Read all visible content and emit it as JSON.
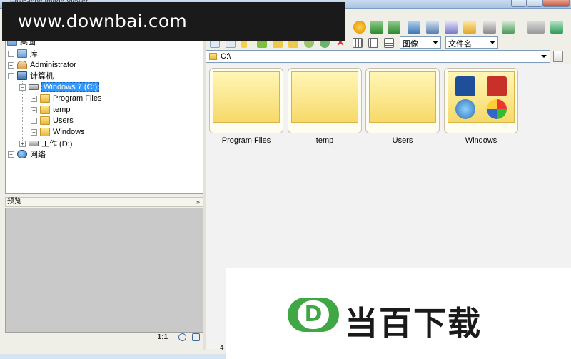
{
  "window": {
    "title": "FastStone Image Viewer"
  },
  "watermark_top": "www.downbai.com",
  "watermark_bottom": "当百下载",
  "toolbar": {
    "view_combo": "图像",
    "sort_combo": "文件名"
  },
  "path": "C:\\",
  "tree": {
    "desktop": "桌面",
    "items": [
      {
        "label": "库",
        "icon": "library-icon"
      },
      {
        "label": "Administrator",
        "icon": "user-folder-icon"
      },
      {
        "label": "计算机",
        "icon": "computer-icon"
      },
      {
        "label": "Windows 7 (C:)",
        "icon": "drive-icon",
        "selected": true
      },
      {
        "label": "Program Files",
        "icon": "folder-icon"
      },
      {
        "label": "temp",
        "icon": "folder-icon"
      },
      {
        "label": "Users",
        "icon": "folder-icon"
      },
      {
        "label": "Windows",
        "icon": "folder-icon"
      },
      {
        "label": "工作 (D:)",
        "icon": "drive-icon"
      },
      {
        "label": "网络",
        "icon": "network-icon"
      }
    ]
  },
  "preview": {
    "title": "预览",
    "zoom": "1:1"
  },
  "thumbnails": [
    {
      "label": "Program Files"
    },
    {
      "label": "temp"
    },
    {
      "label": "Users"
    },
    {
      "label": "Windows"
    }
  ],
  "status": {
    "count": "4"
  },
  "colors": {
    "selection": "#3399ff",
    "folder": "#f7d96a",
    "logo_green": "#3fa845"
  }
}
